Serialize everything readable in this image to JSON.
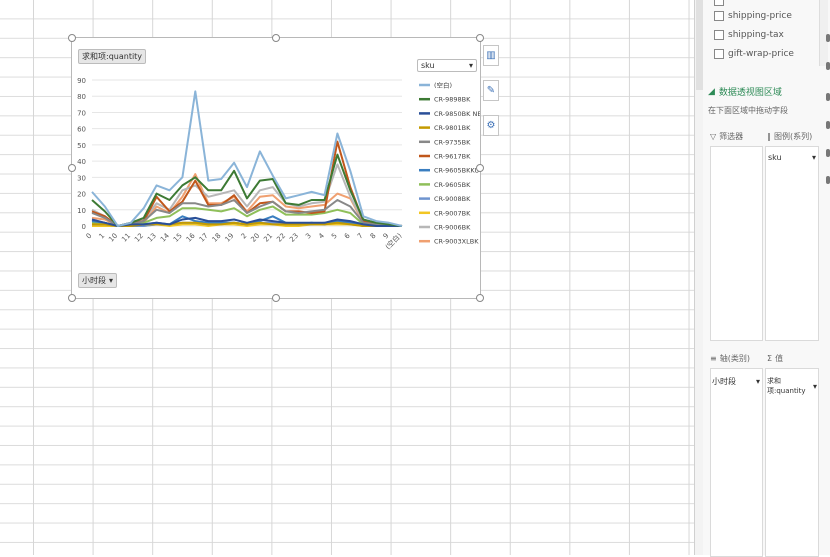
{
  "pivot_fields": [
    {
      "label": "",
      "checked": false
    },
    {
      "label": "shipping-price",
      "checked": false
    },
    {
      "label": "shipping-tax",
      "checked": false
    },
    {
      "label": "gift-wrap-price",
      "checked": false
    }
  ],
  "pivot_area": {
    "title": "数据透视图区域",
    "hint": "在下面区域中拖动字段",
    "filter_label": "筛选器",
    "legend_label": "图例(系列)",
    "legend_value": "sku",
    "axis_label": "轴(类别)",
    "axis_value": "小时段",
    "values_label": "值",
    "values_value": "求和项:quantity"
  },
  "chart_buttons": {
    "value_field": "求和项:quantity",
    "axis_field": "小时段",
    "legend_field": "sku"
  },
  "chart_data": {
    "type": "line",
    "ylim": [
      0,
      90
    ],
    "yticks": [
      "90",
      "80",
      "70",
      "60",
      "50",
      "40",
      "30",
      "20",
      "10",
      "0"
    ],
    "categories": [
      "0",
      "1",
      "10",
      "11",
      "12",
      "13",
      "14",
      "15",
      "16",
      "17",
      "18",
      "19",
      "2",
      "20",
      "21",
      "22",
      "23",
      "3",
      "4",
      "5",
      "6",
      "7",
      "8",
      "9",
      "(空白)"
    ],
    "series": [
      {
        "name": "(空白)",
        "color": "#8ab4d8",
        "values": [
          21,
          12,
          0,
          2,
          11,
          25,
          22,
          30,
          83,
          28,
          29,
          39,
          24,
          46,
          31,
          17,
          19,
          21,
          19,
          57,
          34,
          6,
          3,
          2,
          0
        ]
      },
      {
        "name": "CR-9898BK",
        "color": "#3d7a34",
        "values": [
          16,
          9,
          0,
          2,
          5,
          20,
          16,
          25,
          30,
          22,
          22,
          34,
          17,
          28,
          29,
          14,
          13,
          16,
          16,
          44,
          22,
          4,
          2,
          1,
          0
        ]
      },
      {
        "name": "CR-9850BK NEW",
        "color": "#2a4f98",
        "values": [
          4,
          2,
          0,
          1,
          1,
          2,
          1,
          4,
          5,
          3,
          3,
          4,
          2,
          4,
          3,
          2,
          2,
          2,
          2,
          4,
          3,
          1,
          0,
          0,
          0
        ]
      },
      {
        "name": "CR-9801BK",
        "color": "#c49a00",
        "values": [
          1,
          1,
          0,
          0,
          1,
          1,
          1,
          2,
          2,
          1,
          1,
          2,
          1,
          2,
          1,
          1,
          1,
          1,
          1,
          2,
          1,
          0,
          0,
          0,
          0
        ]
      },
      {
        "name": "CR-9735BK",
        "color": "#888888",
        "values": [
          8,
          5,
          0,
          1,
          3,
          10,
          8,
          14,
          14,
          12,
          13,
          16,
          8,
          12,
          15,
          9,
          8,
          9,
          10,
          16,
          12,
          2,
          1,
          1,
          0
        ]
      },
      {
        "name": "CR-9617BK",
        "color": "#c0571b",
        "values": [
          9,
          6,
          0,
          2,
          3,
          18,
          9,
          15,
          28,
          13,
          13,
          19,
          8,
          14,
          15,
          9,
          9,
          8,
          9,
          52,
          24,
          3,
          2,
          1,
          0
        ]
      },
      {
        "name": "CR-9605BKKU",
        "color": "#3a7ec0",
        "values": [
          3,
          2,
          0,
          0,
          1,
          2,
          1,
          6,
          3,
          2,
          2,
          2,
          1,
          3,
          6,
          2,
          1,
          2,
          1,
          3,
          2,
          0,
          0,
          0,
          0
        ]
      },
      {
        "name": "CR-9605BK",
        "color": "#8fbf5a",
        "values": [
          2,
          2,
          0,
          1,
          2,
          5,
          6,
          11,
          11,
          10,
          9,
          11,
          6,
          10,
          12,
          7,
          7,
          7,
          8,
          10,
          8,
          1,
          1,
          0,
          0
        ]
      },
      {
        "name": "CR-9008BK",
        "color": "#6f94cf",
        "values": [
          1,
          1,
          0,
          0,
          0,
          1,
          1,
          2,
          2,
          1,
          2,
          2,
          1,
          2,
          2,
          1,
          1,
          1,
          2,
          2,
          2,
          0,
          0,
          0,
          0
        ]
      },
      {
        "name": "CR-9007BK",
        "color": "#f2c623",
        "values": [
          0,
          0,
          0,
          0,
          0,
          1,
          0,
          1,
          1,
          0,
          1,
          1,
          0,
          1,
          1,
          0,
          0,
          1,
          1,
          1,
          1,
          0,
          0,
          0,
          0
        ]
      },
      {
        "name": "CR-9006BK",
        "color": "#b7b7b7",
        "values": [
          10,
          6,
          0,
          2,
          4,
          14,
          10,
          22,
          25,
          18,
          20,
          22,
          12,
          22,
          24,
          14,
          12,
          14,
          15,
          38,
          18,
          3,
          2,
          1,
          0
        ]
      },
      {
        "name": "CR-9003XLBK",
        "color": "#f0a070",
        "values": [
          5,
          4,
          0,
          1,
          2,
          12,
          8,
          18,
          32,
          14,
          14,
          18,
          9,
          18,
          19,
          12,
          11,
          12,
          13,
          20,
          17,
          2,
          1,
          1,
          0
        ]
      }
    ],
    "legend_position": "right"
  }
}
